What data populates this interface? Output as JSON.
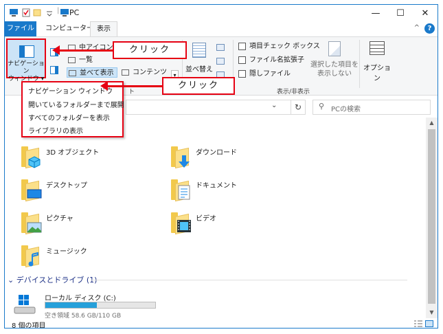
{
  "window": {
    "title": "PC",
    "controls": {
      "minimize": "—",
      "maximize": "☐",
      "close": "✕"
    }
  },
  "ribbon": {
    "tabs": [
      {
        "label": "ファイル"
      },
      {
        "label": "コンピューター"
      },
      {
        "label": "表示"
      }
    ],
    "collapse": "^",
    "help": "?",
    "nav_pane_button": {
      "line1": "ナビゲーション",
      "line2": "ウィンドウ ▾"
    },
    "layouts": {
      "medium_icons": "中アイコン",
      "list": "一覧",
      "details": "並べて表示",
      "content": "コンテンツ"
    },
    "sort_button": "並べ替え",
    "show_hide": {
      "item_checkboxes": "項目チェック ボックス",
      "file_extensions": "ファイル名拡張子",
      "hidden_items": "隠しファイル",
      "hide_selected": "選択した項目を表示しない",
      "group_label": "表示/非表示"
    },
    "options": "オプション",
    "layout_group_partial": "ト"
  },
  "nav_dropdown": {
    "items": [
      "ナビゲーション ウィンドウ",
      "開いているフォルダーまで展開",
      "すべてのフォルダーを表示",
      "ライブラリの表示"
    ]
  },
  "address": {
    "refresh": "↻",
    "search_placeholder": "PCの検索"
  },
  "folders": [
    {
      "name": "3D オブジェクト"
    },
    {
      "name": "ダウンロード"
    },
    {
      "name": "デスクトップ"
    },
    {
      "name": "ドキュメント"
    },
    {
      "name": "ピクチャ"
    },
    {
      "name": "ビデオ"
    },
    {
      "name": "ミュージック"
    }
  ],
  "devices": {
    "heading": "デバイスとドライブ (1)",
    "drive": {
      "label": "ローカル ディスク (C:)",
      "used_fraction": 0.47,
      "free_text": "空き領域 58.6 GB/110 GB"
    }
  },
  "status": {
    "count": "8 個の項目"
  },
  "annotations": {
    "click_1": "クリック",
    "click_2": "クリック"
  },
  "colors": {
    "accent": "#1979ca",
    "annotation_red": "#e60012",
    "folder_yellow": "#f2c94c",
    "drive_bar": "#26a0da"
  }
}
